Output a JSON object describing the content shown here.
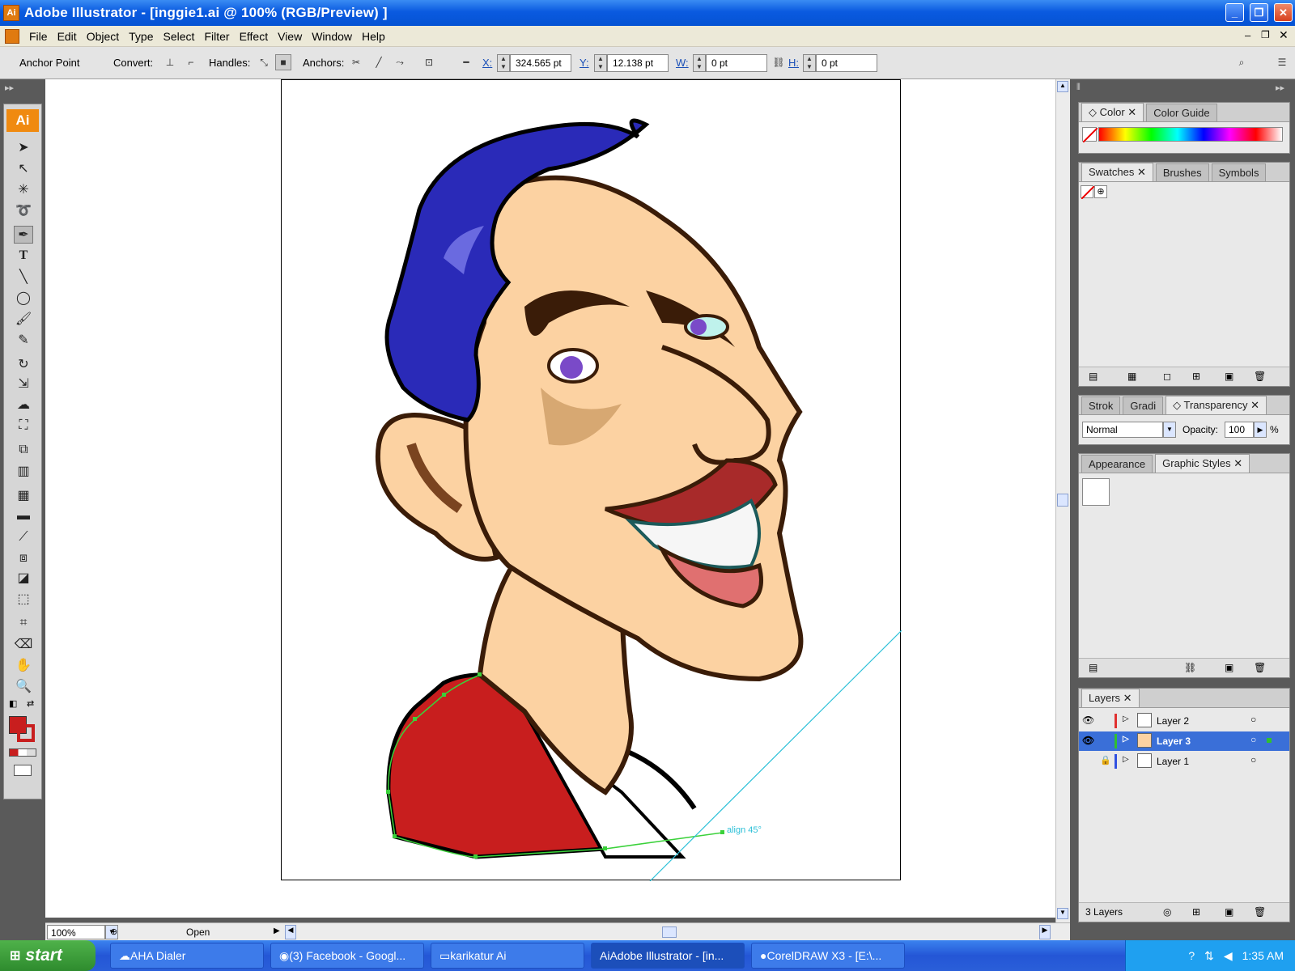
{
  "window": {
    "title": "Adobe Illustrator - [inggie1.ai @ 100% (RGB/Preview) ]",
    "app_icon": "Ai"
  },
  "menu": {
    "items": [
      "File",
      "Edit",
      "Object",
      "Type",
      "Select",
      "Filter",
      "Effect",
      "View",
      "Window",
      "Help"
    ]
  },
  "control": {
    "tool_label": "Anchor Point",
    "convert_label": "Convert:",
    "handles_label": "Handles:",
    "anchors_label": "Anchors:",
    "x_label": "X:",
    "x_value": "324.565 pt",
    "y_label": "Y:",
    "y_value": "12.138 pt",
    "w_label": "W:",
    "w_value": "0 pt",
    "h_label": "H:",
    "h_value": "0 pt"
  },
  "toolbox": {
    "logo": "Ai"
  },
  "status": {
    "zoom": "100%",
    "state": "Open"
  },
  "canvas": {
    "guide_label": "align 45°"
  },
  "panels": {
    "color": {
      "tabs": [
        "Color",
        "Color Guide"
      ]
    },
    "swatches": {
      "tabs": [
        "Swatches",
        "Brushes",
        "Symbols"
      ]
    },
    "transparency": {
      "tabs": [
        "Strok",
        "Gradi",
        "Transparency"
      ],
      "blend_mode": "Normal",
      "opacity_label": "Opacity:",
      "opacity_value": "100",
      "percent": "%"
    },
    "appearance": {
      "tabs": [
        "Appearance",
        "Graphic Styles"
      ]
    },
    "layers": {
      "tabs": [
        "Layers"
      ],
      "items": [
        {
          "name": "Layer 2",
          "color": "#e03030"
        },
        {
          "name": "Layer 3",
          "color": "#30c030"
        },
        {
          "name": "Layer 1",
          "color": "#3050e0"
        }
      ],
      "count": "3 Layers"
    }
  },
  "taskbar": {
    "start": "start",
    "tasks": [
      "AHA Dialer",
      "(3) Facebook - Googl...",
      "karikatur Ai",
      "Adobe Illustrator - [in...",
      "CorelDRAW X3 - [E:\\..."
    ],
    "time": "1:35 AM"
  },
  "colors": {
    "hair": "#2a2ab8",
    "skin": "#fcd2a2",
    "shirt": "#c81e1e",
    "selection": "#2cc0d8"
  }
}
